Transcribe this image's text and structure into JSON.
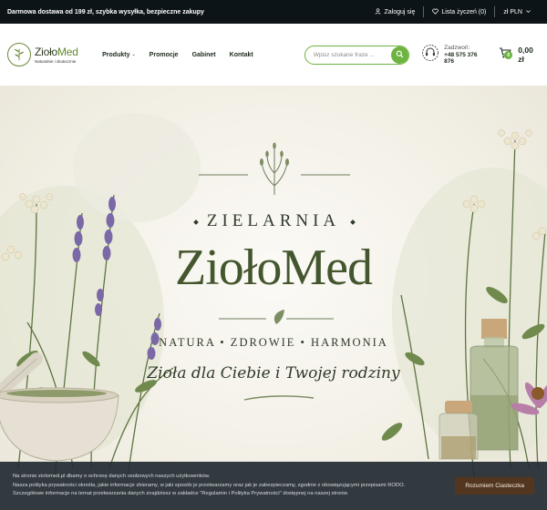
{
  "topbar": {
    "promo": "Darmowa dostawa od 199 zł, szybka wysyłka, bezpieczne zakupy",
    "login": "Zaloguj się",
    "wishlist": "Lista życzeń (0)",
    "currency": "zł PLN",
    "icons": [
      "user-icon",
      "heart-icon",
      "chevron-down-icon"
    ]
  },
  "header": {
    "logo_name_a": "Zioło",
    "logo_name_b": "Med",
    "logo_tagline": "Naturalnie i skutecznie",
    "nav": [
      {
        "label": "Produkty",
        "dropdown": true
      },
      {
        "label": "Promocje"
      },
      {
        "label": "Gabinet"
      },
      {
        "label": "Kontakt"
      }
    ],
    "search": {
      "placeholder": "Wpisz szukane fraze ...",
      "value": ""
    },
    "contact": {
      "label": "Zadzwoń:",
      "phone": "+48 575 376 876"
    },
    "cart": {
      "count": "0",
      "total": "0,00 zł"
    }
  },
  "hero": {
    "subtitle": "ZIELARNIA",
    "title": "ZiołoMed",
    "values": "NATURA • ZDROWIE • HARMONIA",
    "slogan": "Zioła dla Ciebie i Twojej rodziny"
  },
  "cookie": {
    "text_line1": "Na stronie ziolomed.pl dbamy o ochronę danych osobowych naszych użytkowników.",
    "text_line2": "Nasza polityka prywatności określa, jakie informacje zbieramy, w jaki sposób je przetwarzamy oraz jak je zabezpieczamy, zgodnie z obowiązującymi przepisami RODO.",
    "text_line3": "Szczegółowe informacje na temat przetwarzania danych znajdziesz w zakładce \"Regulamin i Polityka Prywatności\" dostępnej na naszej stronie.",
    "button": "Rozumiem Ciasteczka"
  },
  "colors": {
    "accent": "#6cb33f",
    "topbar": "#0c1418",
    "title_green": "#44562e",
    "cookie_button": "#53361f"
  }
}
